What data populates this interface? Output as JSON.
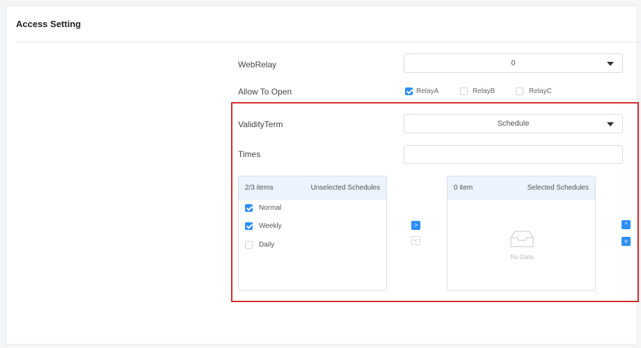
{
  "section": {
    "title": "Access Setting"
  },
  "web_relay": {
    "label": "WebRelay",
    "value": "0"
  },
  "allow_to_open": {
    "label": "Allow To Open",
    "options": [
      {
        "label": "RelayA",
        "checked": true
      },
      {
        "label": "RelayB",
        "checked": false
      },
      {
        "label": "RelayC",
        "checked": false
      }
    ]
  },
  "validity_term": {
    "label": "ValidityTerm",
    "value": "Schedule"
  },
  "times": {
    "label": "Times",
    "value": ""
  },
  "unselected": {
    "count": "2/3 items",
    "title": "Unselected Schedules",
    "items": [
      {
        "label": "Normal",
        "checked": true
      },
      {
        "label": "Weekly",
        "checked": true
      },
      {
        "label": "Daily",
        "checked": false
      }
    ]
  },
  "selected": {
    "count": "0 item",
    "title": "Selected Schedules",
    "empty_text": "No Data"
  },
  "buttons": {
    "move_right": ">",
    "move_left": "<",
    "move_up": "^",
    "move_down": "v"
  },
  "colors": {
    "accent": "#2b8ff5",
    "highlight": "#d32b2b"
  }
}
